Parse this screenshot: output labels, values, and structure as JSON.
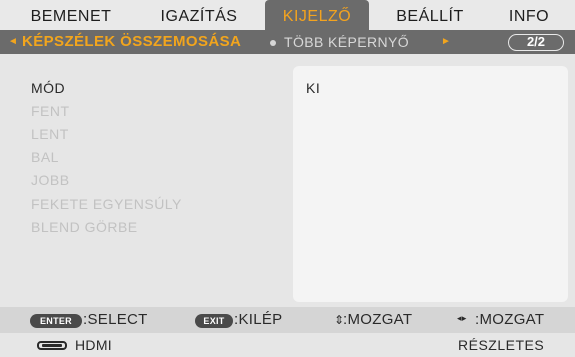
{
  "tabs": [
    {
      "label": "BEMENET",
      "active": false
    },
    {
      "label": "IGAZÍTÁS",
      "active": false
    },
    {
      "label": "KIJELZŐ",
      "active": true
    },
    {
      "label": "BEÁLLÍT",
      "active": false
    },
    {
      "label": "INFO",
      "active": false
    }
  ],
  "submenu": {
    "left_arrow": "◄",
    "active": "KÉPSZÉLEK ÖSSZEMOSÁSA",
    "other": "TÖBB KÉPERNYŐ",
    "right_arrow": "►",
    "page": "2/2"
  },
  "menu_items": [
    {
      "label": "MÓD",
      "enabled": true
    },
    {
      "label": "FENT",
      "enabled": false
    },
    {
      "label": "LENT",
      "enabled": false
    },
    {
      "label": "BAL",
      "enabled": false
    },
    {
      "label": "JOBB",
      "enabled": false
    },
    {
      "label": "FEKETE EGYENSÚLY",
      "enabled": false
    },
    {
      "label": "BLEND GÖRBE",
      "enabled": false
    }
  ],
  "value_panel": {
    "value": "KI"
  },
  "help": {
    "enter_key": "ENTER",
    "enter_text": ":SELECT",
    "exit_key": "EXIT",
    "exit_text": ":KILÉP",
    "updown_symbol": "⇕",
    "updown_text": ":MOZGAT",
    "leftright_symbol": "◂▸",
    "leftright_text": ":MOZGAT"
  },
  "status": {
    "source_icon": "hdmi-icon",
    "source": "HDMI",
    "details": "RÉSZLETES"
  },
  "colors": {
    "accent": "#f2a51d",
    "bar": "#6b6b6b",
    "background": "#e6e6e6",
    "panel": "#f4f4f4",
    "disabled_text": "#c2c2c2"
  }
}
